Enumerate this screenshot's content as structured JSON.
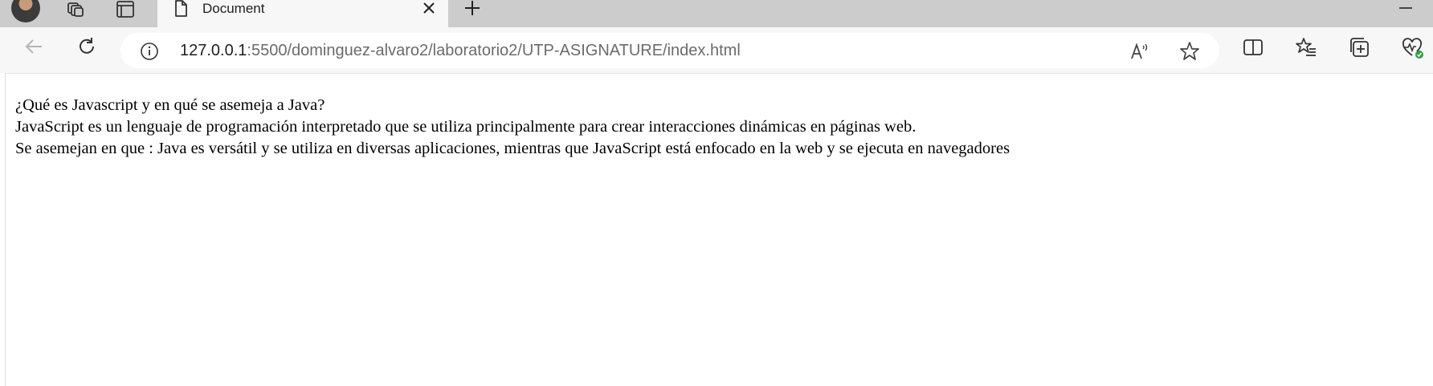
{
  "browser": {
    "tab": {
      "title": "Document"
    },
    "address_bar": {
      "host": "127.0.0.1",
      "path": ":5500/dominguez-alvaro2/laboratorio2/UTP-ASIGNATURE/index.html"
    }
  },
  "page": {
    "lines": [
      "¿Qué es Javascript y en qué se asemeja a Java?",
      "JavaScript es un lenguaje de programación interpretado que se utiliza principalmente para crear interacciones dinámicas en páginas web.",
      "Se asemejan en que : Java es versátil y se utiliza en diversas aplicaciones, mientras que JavaScript está enfocado en la web y se ejecuta en navegadores"
    ]
  },
  "icons": {
    "workspaces": "workspaces-icon",
    "tab_actions": "tab-actions-icon",
    "document": "document-icon",
    "close": "close-icon",
    "new_tab": "plus-icon",
    "minimize": "minimize-icon",
    "back": "back-arrow-icon",
    "refresh": "refresh-icon",
    "site_info": "info-icon",
    "read_aloud": "read-aloud-icon",
    "favorite": "star-icon",
    "split_screen": "split-screen-icon",
    "favorites": "favorites-icon",
    "collections": "collections-icon",
    "browser_essentials": "heart-pulse-icon"
  },
  "colors": {
    "tabstrip": "#cccccc",
    "toolbar": "#f7f7f7",
    "essentials_badge": "#2e9e3e"
  }
}
